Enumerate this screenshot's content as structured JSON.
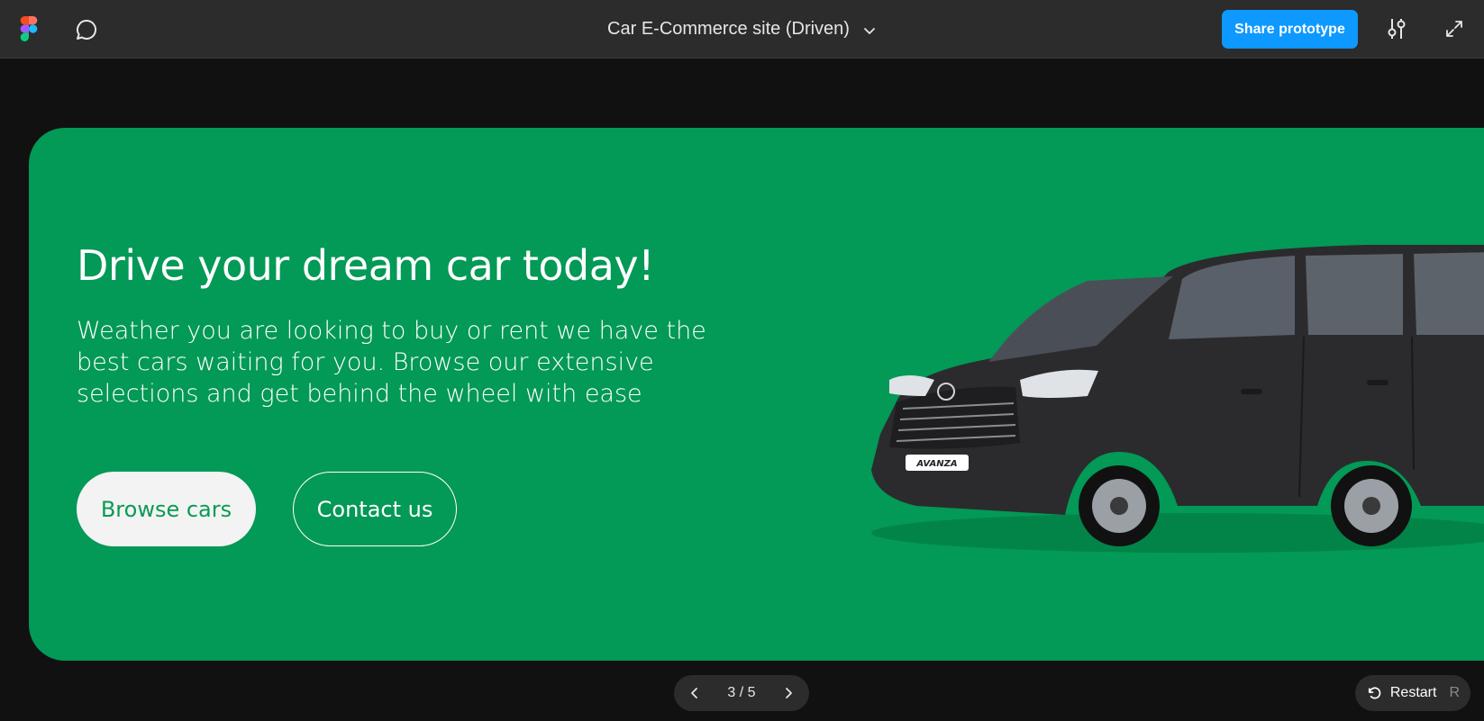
{
  "app": {
    "file_title": "Car E-Commerce site (Driven)",
    "share_label": "Share prototype",
    "icons": [
      "figma-logo-icon",
      "comment-icon",
      "chevron-down-icon",
      "settings-sliders-icon",
      "expand-icon",
      "chevron-left-icon",
      "chevron-right-icon",
      "restart-icon"
    ]
  },
  "hero": {
    "title": "Drive your dream car today!",
    "subtitle": "Weather you are looking to buy or rent we have the best cars waiting for you. Browse our extensive selections and get behind the wheel with ease",
    "primary_button": "Browse cars",
    "secondary_button": "Contact us",
    "car_badge": "AVANZA",
    "background_color": "#039956"
  },
  "footer": {
    "page_indicator": "3 / 5",
    "restart_label": "Restart",
    "restart_shortcut": "R"
  },
  "colors": {
    "topbar": "#2c2c2c",
    "canvas": "#111111",
    "accent": "#0d99ff",
    "hero_green": "#039956"
  }
}
